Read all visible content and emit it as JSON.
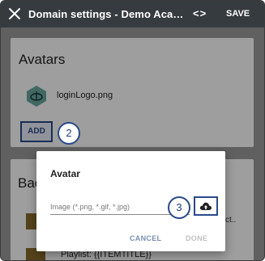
{
  "appbar": {
    "title": "Domain settings - Demo Aca…",
    "code_label": "<>",
    "save_label": "SAVE"
  },
  "avatars": {
    "heading": "Avatars",
    "file_name": "loginLogo.png",
    "add_label": "ADD"
  },
  "background": {
    "heading": "Bac",
    "item_trailing": "ct..",
    "item_text": "Playlist: {{ITEMTITLE}}"
  },
  "dialog": {
    "title": "Avatar",
    "input_placeholder": "Image (*.png, *.gif, *.jpg)",
    "input_value": "",
    "cancel_label": "CANCEL",
    "done_label": "DONE"
  },
  "callouts": {
    "step_add": "2",
    "step_upload": "3"
  },
  "colors": {
    "appbar": "#363b40",
    "accent": "#2a4a8a",
    "hex_icon": "#6aa8a0",
    "overlay": "rgba(0,0,0,0.38)"
  },
  "icons": [
    "close-icon",
    "code-icon",
    "hex-logo-icon",
    "cloud-upload-icon"
  ]
}
